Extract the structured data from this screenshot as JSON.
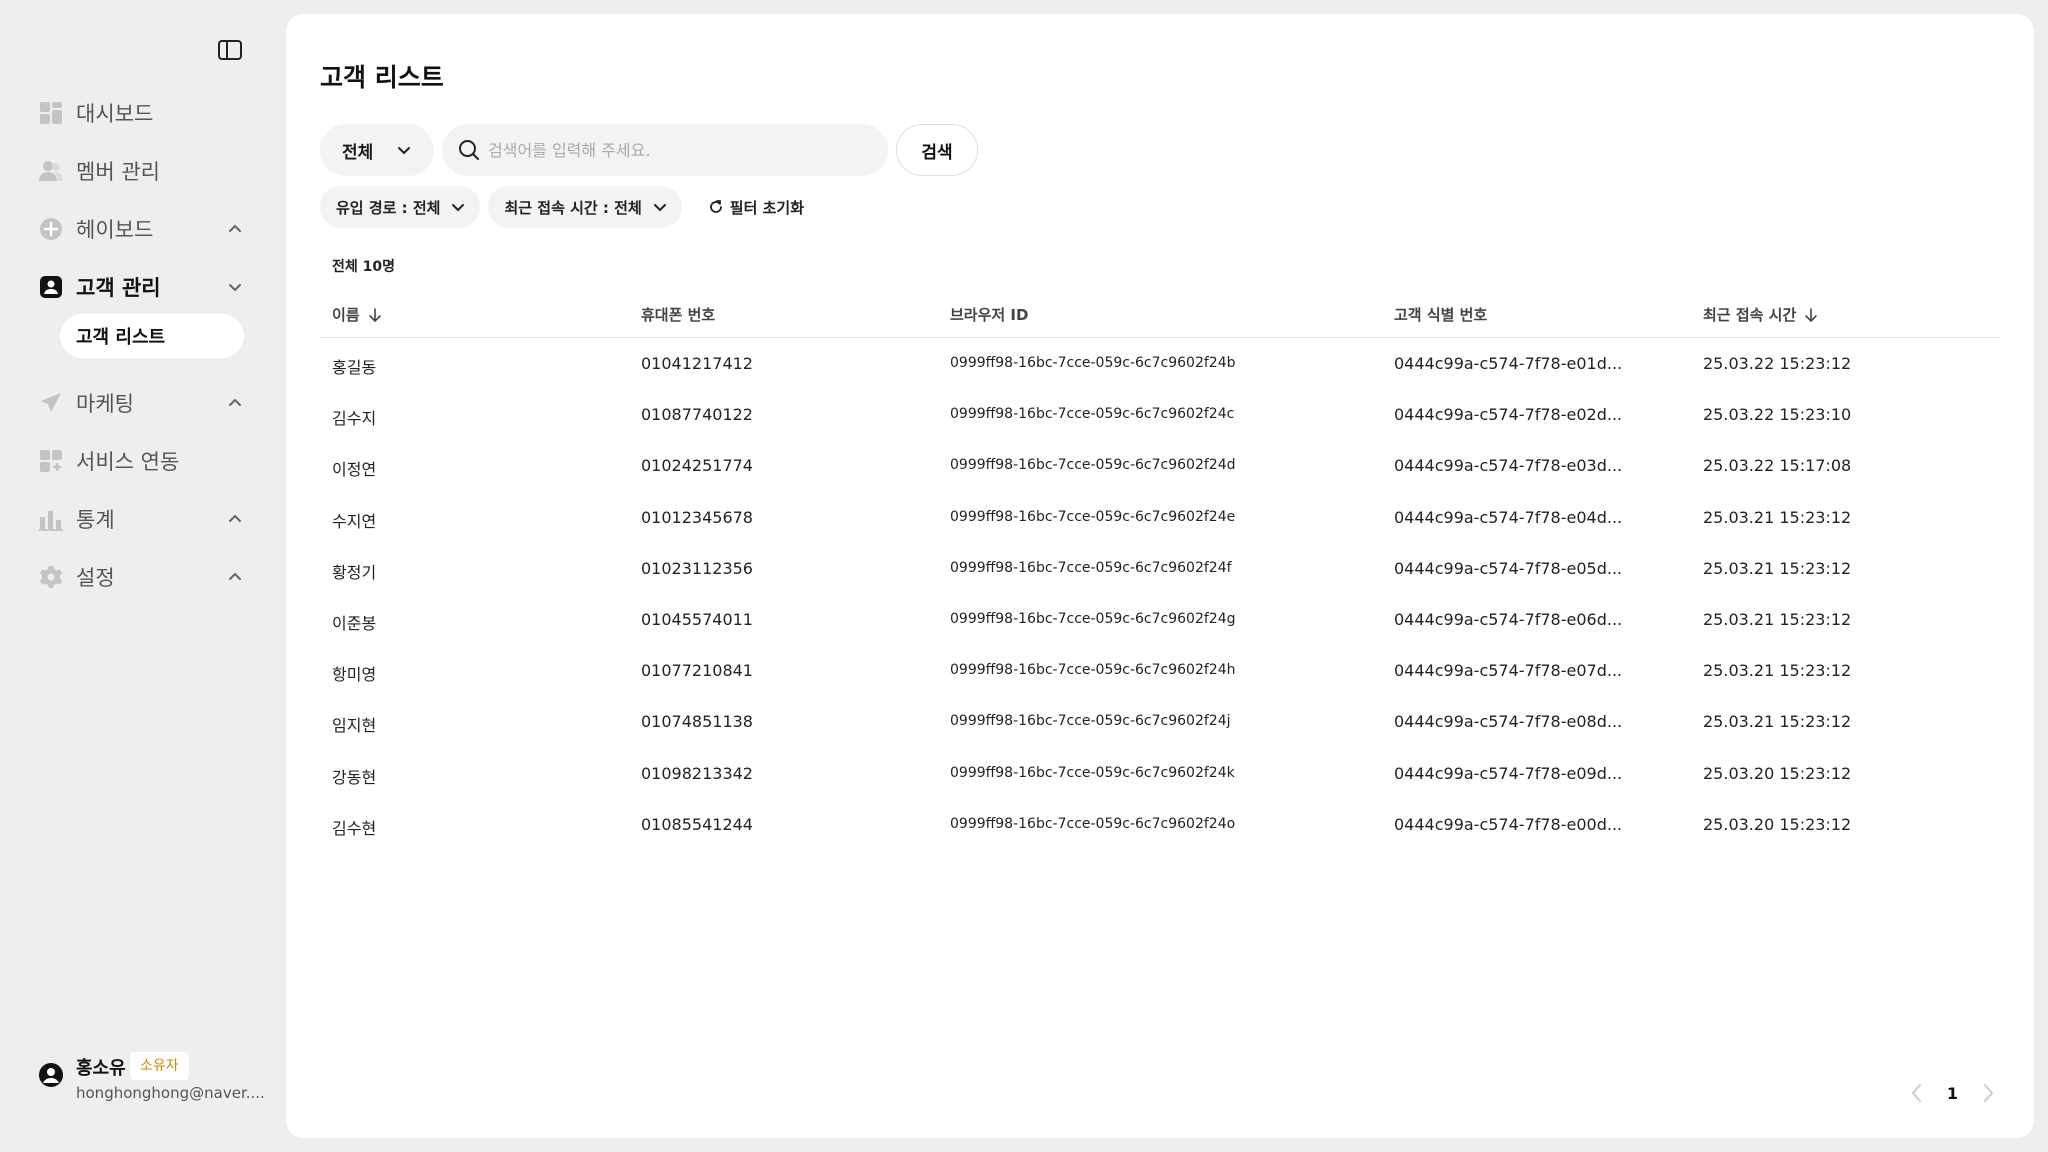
{
  "sidebar": {
    "items": [
      {
        "label": "대시보드",
        "icon": "dashboard-icon"
      },
      {
        "label": "멤버 관리",
        "icon": "members-icon"
      },
      {
        "label": "헤이보드",
        "icon": "plus-circle-icon"
      },
      {
        "label": "고객 관리",
        "icon": "customer-icon"
      },
      {
        "label": "마케팅",
        "icon": "send-icon"
      },
      {
        "label": "서비스 연동",
        "icon": "integration-icon"
      },
      {
        "label": "통계",
        "icon": "chart-icon"
      },
      {
        "label": "설정",
        "icon": "gear-icon"
      }
    ],
    "sub_item": "고객 리스트",
    "user": {
      "name": "홍소유",
      "badge": "소유자",
      "email": "honghonghong@naver...."
    }
  },
  "main": {
    "title": "고객 리스트",
    "search": {
      "select_value": "전체",
      "placeholder": "검색어를 입력해 주세요.",
      "button": "검색"
    },
    "filters": {
      "source": "유입 경로 : 전체",
      "last_access": "최근 접속 시간 : 전체",
      "reset": "필터 초기화"
    },
    "total": "전체 10명",
    "columns": [
      "이름",
      "휴대폰 번호",
      "브라우저 ID",
      "고객 식별 번호",
      "최근 접속 시간"
    ],
    "rows": [
      [
        "홍길동",
        "01041217412",
        "0999ff98-16bc-7cce-059c-6c7c9602f24b",
        "0444c99a-c574-7f78-e01d...",
        "25.03.22 15:23:12"
      ],
      [
        "김수지",
        "01087740122",
        "0999ff98-16bc-7cce-059c-6c7c9602f24c",
        "0444c99a-c574-7f78-e02d...",
        "25.03.22 15:23:10"
      ],
      [
        "이정연",
        "01024251774",
        "0999ff98-16bc-7cce-059c-6c7c9602f24d",
        "0444c99a-c574-7f78-e03d...",
        "25.03.22 15:17:08"
      ],
      [
        "수지연",
        "01012345678",
        "0999ff98-16bc-7cce-059c-6c7c9602f24e",
        "0444c99a-c574-7f78-e04d...",
        "25.03.21 15:23:12"
      ],
      [
        "황정기",
        "01023112356",
        "0999ff98-16bc-7cce-059c-6c7c9602f24f",
        "0444c99a-c574-7f78-e05d...",
        "25.03.21 15:23:12"
      ],
      [
        "이준봉",
        "01045574011",
        "0999ff98-16bc-7cce-059c-6c7c9602f24g",
        "0444c99a-c574-7f78-e06d...",
        "25.03.21 15:23:12"
      ],
      [
        "항미영",
        "01077210841",
        "0999ff98-16bc-7cce-059c-6c7c9602f24h",
        "0444c99a-c574-7f78-e07d...",
        "25.03.21 15:23:12"
      ],
      [
        "임지현",
        "01074851138",
        "0999ff98-16bc-7cce-059c-6c7c9602f24j",
        "0444c99a-c574-7f78-e08d...",
        "25.03.21 15:23:12"
      ],
      [
        "강동현",
        "01098213342",
        "0999ff98-16bc-7cce-059c-6c7c9602f24k",
        "0444c99a-c574-7f78-e09d...",
        "25.03.20 15:23:12"
      ],
      [
        "김수현",
        "01085541244",
        "0999ff98-16bc-7cce-059c-6c7c9602f24o",
        "0444c99a-c574-7f78-e00d...",
        "25.03.20 15:23:12"
      ]
    ],
    "pagination": {
      "current": "1"
    }
  },
  "colors": {
    "icon_gray": "#c4c4c4",
    "badge_text": "#d08a00",
    "active_text": "#111111"
  }
}
